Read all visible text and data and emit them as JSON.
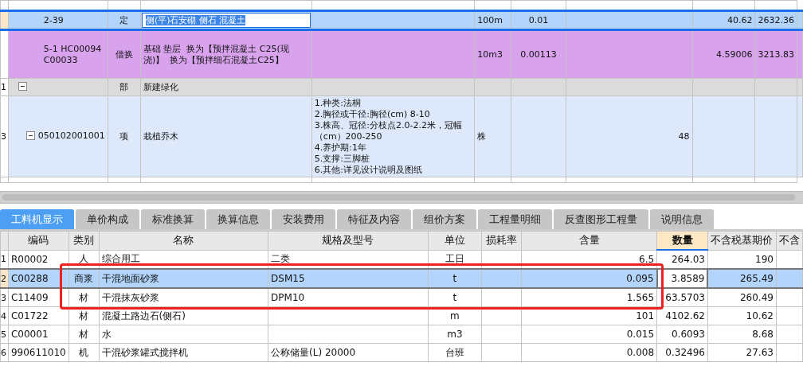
{
  "upper_table": {
    "rows": [
      {
        "kind": "quota",
        "selected": true,
        "editing": true,
        "row_number": "",
        "cells": [
          "2-39",
          "定",
          "侧(平)石安砌 侧石 混凝土",
          "",
          "100m",
          "0.01",
          "",
          "40.62",
          "2632.36"
        ]
      },
      {
        "kind": "substitution",
        "selected": false,
        "editing": false,
        "row_number": "",
        "cells": [
          "5-1 HC00094 C00033",
          "借换",
          "基础 垫层  换为【预拌混凝土 C25(现浇)】  换为【预拌细石混凝土C25】",
          "",
          "10m3",
          "0.00113",
          "",
          "4.59006",
          "3213.83"
        ]
      },
      {
        "kind": "section",
        "selected": false,
        "editing": false,
        "expanded": true,
        "row_number": "1",
        "cells": [
          "",
          "部",
          "新建绿化",
          "",
          "",
          "",
          "",
          "",
          ""
        ],
        "children": [
          {
            "kind": "item",
            "selected": false,
            "editing": false,
            "expanded": true,
            "row_number": "3",
            "cells": [
              "050102001001",
              "项",
              "栽植乔木",
              "1.种类:法桐\n2.胸径或干径:胸径(cm) 8-10\n3.株高、冠径:分枝点2.0-2.2米，冠幅（cm）200-250\n4.养护期:1年\n5.支撑:三脚桩\n6.其他:详见设计说明及图纸",
              "株",
              "",
              "48",
              "",
              ""
            ]
          }
        ]
      }
    ]
  },
  "tabs": [
    {
      "label": "工料机显示",
      "selected": true
    },
    {
      "label": "单价构成",
      "selected": false
    },
    {
      "label": "标准换算",
      "selected": false
    },
    {
      "label": "换算信息",
      "selected": false
    },
    {
      "label": "安装费用",
      "selected": false
    },
    {
      "label": "特征及内容",
      "selected": false
    },
    {
      "label": "组价方案",
      "selected": false
    },
    {
      "label": "工程量明细",
      "selected": false
    },
    {
      "label": "反查图形工程量",
      "selected": false
    },
    {
      "label": "说明信息",
      "selected": false
    }
  ],
  "lower_table": {
    "columns": [
      {
        "label": "编码",
        "selected": false
      },
      {
        "label": "类别",
        "selected": false
      },
      {
        "label": "名称",
        "selected": false
      },
      {
        "label": "规格及型号",
        "selected": false
      },
      {
        "label": "单位",
        "selected": false
      },
      {
        "label": "损耗率",
        "selected": false
      },
      {
        "label": "含量",
        "selected": false
      },
      {
        "label": "数量",
        "selected": true
      },
      {
        "label": "不含税基期价",
        "selected": false
      },
      {
        "label": "不含",
        "selected": false
      }
    ],
    "rows": [
      {
        "row_number": "1",
        "selected": false,
        "circled": false,
        "cells": [
          "R00002",
          "人",
          "综合用工",
          "二类",
          "工日",
          "",
          "6.5",
          "264.03",
          "190",
          ""
        ]
      },
      {
        "row_number": "2",
        "selected": true,
        "circled": true,
        "cells": [
          "C00288",
          "商浆",
          "干混地面砂浆",
          "DSM15",
          "t",
          "",
          "0.095",
          "3.8589",
          "265.49",
          ""
        ]
      },
      {
        "row_number": "3",
        "selected": false,
        "circled": true,
        "cells": [
          "C11409",
          "材",
          "干混抹灰砂浆",
          "DPM10",
          "t",
          "",
          "1.565",
          "63.5703",
          "260.49",
          ""
        ]
      },
      {
        "row_number": "4",
        "selected": false,
        "circled": false,
        "cells": [
          "C01722",
          "材",
          "混凝土路边石(侧石)",
          "",
          "m",
          "",
          "101",
          "4102.62",
          "10.62",
          ""
        ]
      },
      {
        "row_number": "5",
        "selected": false,
        "circled": false,
        "cells": [
          "C00001",
          "材",
          "水",
          "",
          "m3",
          "",
          "0.015",
          "0.6093",
          "8.68",
          ""
        ]
      },
      {
        "row_number": "6",
        "selected": false,
        "circled": false,
        "cells": [
          "990611010",
          "机",
          "干混砂浆罐式搅拌机",
          "公称储量(L) 20000",
          "台班",
          "",
          "0.008",
          "0.32496",
          "27.63",
          ""
        ]
      }
    ]
  }
}
